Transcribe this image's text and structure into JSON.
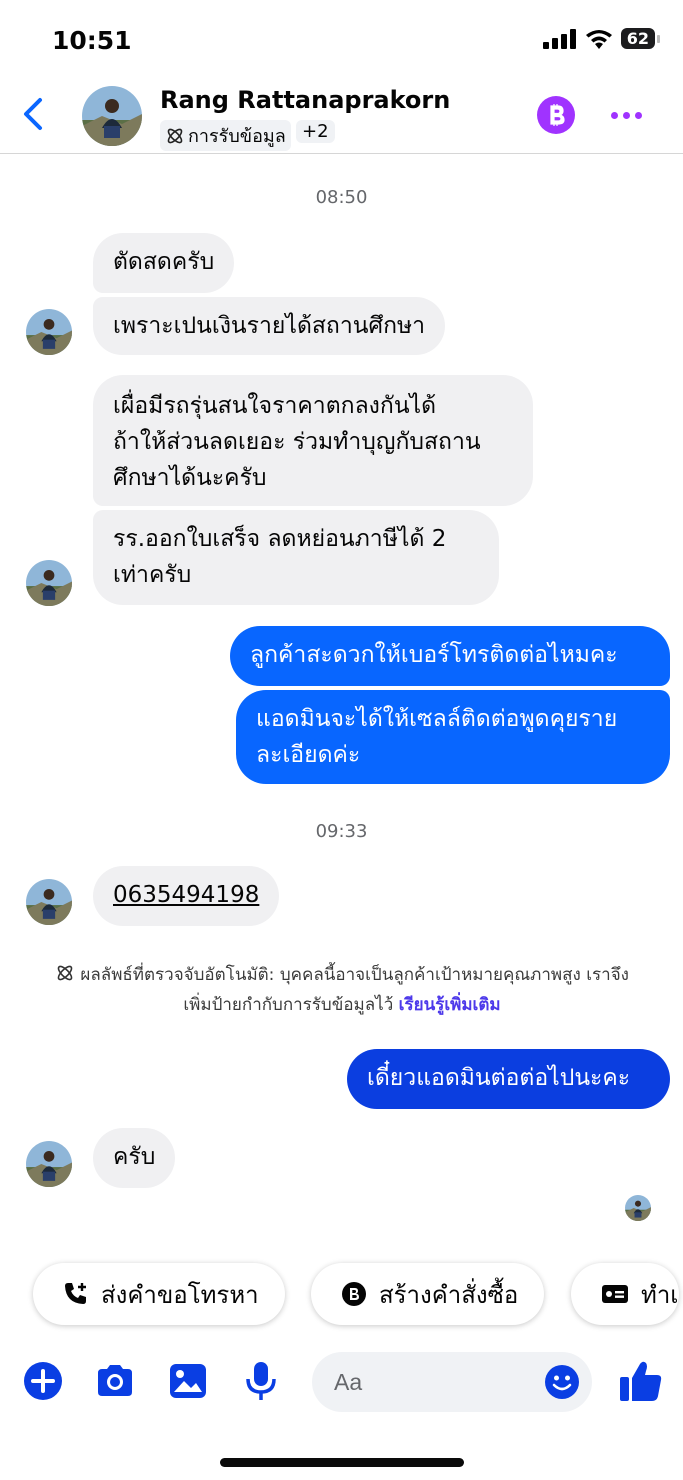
{
  "status_bar": {
    "time": "10:51",
    "battery": "62"
  },
  "header": {
    "name": "Rang Rattanaprakorn",
    "label_chip": "การรับข้อมูล",
    "more_labels": "+2"
  },
  "messages": {
    "ts1": "08:50",
    "m1": "ตัดสดครับ",
    "m2": "เพราะเปนเงินรายได้สถานศึกษา",
    "m3_l1": "เผื่อมีรถรุ่นสนใจราคาตกลงกันได้",
    "m3_l2": "ถ้าให้ส่วนลดเยอะ ร่วมทำบุญกับสถาน",
    "m3_l3": "ศึกษาได้นะครับ",
    "m4_l1": "รร.ออกใบเสร็จ ลดหย่อนภาษีได้ 2",
    "m4_l2": "เท่าครับ",
    "m5": "ลูกค้าสะดวกให้เบอร์โทรติดต่อไหมคะ",
    "m6_l1": "แอดมินจะได้ให้เซลล์ติดต่อพูดคุยราย",
    "m6_l2": "ละเอียดค่ะ",
    "ts2": "09:33",
    "m7": "0635494198",
    "notice_l1": "ผลลัพธ์ที่ตรวจจับอัตโนมัติ: บุคคลนี้อาจเป็นลูกค้าเป้าหมายคุณภาพสูง เราจึง",
    "notice_l2": "เพิ่มป้ายกำกับการรับข้อมูลไว้",
    "notice_link": "เรียนรู้เพิ่มเติม",
    "m8": "เดี๋ยวแอดมินต่อต่อไปนะคะ",
    "m9": "ครับ"
  },
  "quick_actions": {
    "call": "ส่งคำขอโทรหา",
    "order": "สร้างคำสั่งซื้อ",
    "third": "ทำเ"
  },
  "composer": {
    "placeholder": "Aa"
  },
  "colors": {
    "outgoing": "#0866ff",
    "outgoing_dark": "#0b3ee0",
    "incoming": "#f0f0f2",
    "accent_purple": "#a033ff",
    "icon_blue": "#0a3ee3"
  }
}
